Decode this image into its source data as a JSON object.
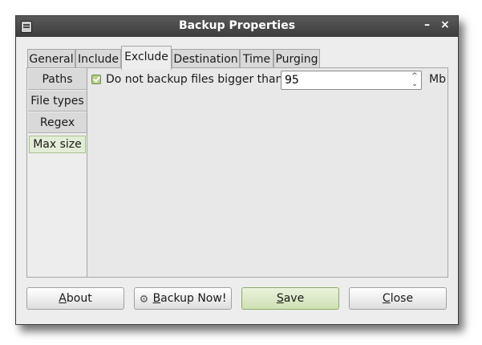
{
  "window": {
    "title": "Backup Properties",
    "minimize": "–",
    "close": "×"
  },
  "tabs": [
    "General",
    "Include",
    "Exclude",
    "Destination",
    "Time",
    "Purging"
  ],
  "side_tabs": [
    "Paths",
    "File types",
    "Regex",
    "Max size"
  ],
  "max_size": {
    "checkbox_label": "Do not backup files bigger than",
    "checked": true,
    "value": "95",
    "unit": "Mb",
    "spin_up": "^",
    "spin_down": "⌄"
  },
  "buttons": {
    "about": {
      "before": "",
      "key": "A",
      "after": "bout"
    },
    "backup_now": {
      "before": "",
      "key": "B",
      "after": "ackup Now!"
    },
    "save": {
      "before": "",
      "key": "S",
      "after": "ave"
    },
    "close": {
      "before": "",
      "key": "C",
      "after": "lose"
    }
  }
}
